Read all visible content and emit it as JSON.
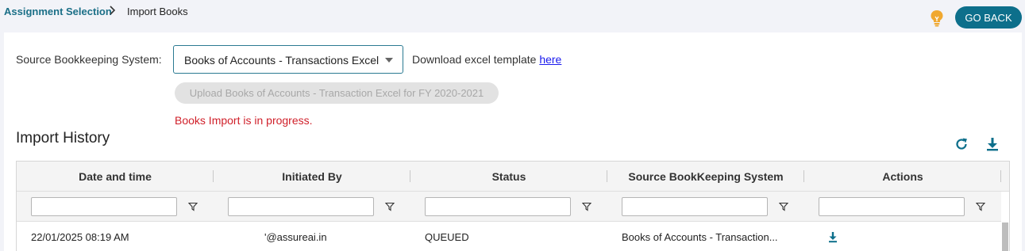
{
  "breadcrumb": {
    "parent": "Assignment Selection",
    "current": "Import Books"
  },
  "header": {
    "go_back_label": "GO BACK",
    "hint_icon": "lightbulb-icon"
  },
  "source": {
    "label": "Source Bookkeeping System:",
    "selected": "Books of Accounts - Transactions Excel",
    "template_text": "Download excel template",
    "template_link": "here"
  },
  "upload": {
    "label": "Upload Books of Accounts - Transaction Excel for FY 2020-2021",
    "disabled": true
  },
  "status_message": "Books Import is in progress.",
  "history": {
    "title": "Import History",
    "refresh_icon": "refresh-icon",
    "download_icon": "download-icon",
    "columns": [
      "Date and time",
      "Initiated By",
      "Status",
      "Source BookKeeping System",
      "Actions"
    ],
    "filters": [
      "",
      "",
      "",
      "",
      ""
    ],
    "rows": [
      {
        "datetime": "22/01/2025 08:19 AM",
        "initiated_by": "'@assureai.in",
        "status": "QUEUED",
        "source": "Books of Accounts - Transaction...",
        "action_icon": "download-icon"
      }
    ]
  },
  "colors": {
    "accent": "#0d6f8b",
    "link": "#1b6f87",
    "error": "#d0202a",
    "bulb": "#f0a830"
  }
}
